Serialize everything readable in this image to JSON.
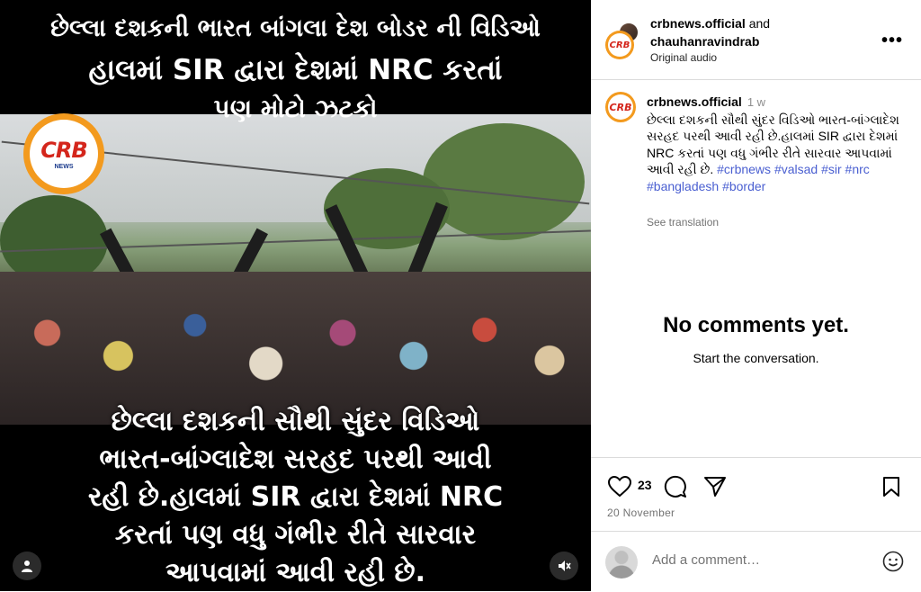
{
  "media": {
    "overlay_top": {
      "line1": "છેલ્લા દશકની ભારત બાંગલા દેશ બોડર ની વિડિઓ",
      "line2": "હાલમાં SIR દ્વારા દેશમાં NRC કરતાં",
      "line3": "પણ મોટો ઝટકો"
    },
    "overlay_bottom": [
      "છેલ્લા દશકની સૌથી સુંદર વિડિઓ",
      "ભારત-બાંગ્લાદેશ સરહદ પરથી આવી",
      "રહી છે.હાલમાં SIR દ્વારા દેશમાં NRC",
      "કરતાં પણ વધુ ગંભીર રીતે સારવાર",
      "આપવામાં આવી રહી છે."
    ],
    "logo": {
      "text": "CRB",
      "sub": "NEWS"
    },
    "icons": {
      "user": "user-tag-icon",
      "mute": "muted-speaker-icon"
    }
  },
  "header": {
    "user1": "crbnews.official",
    "and": "and",
    "user2": "chauhanravindrab",
    "subtitle": "Original audio",
    "more_label": "•••",
    "avatar_text": "CRB"
  },
  "caption": {
    "username": "crbnews.official",
    "time": "1 w",
    "text": "છેલ્લા દશકની સૌથી સુંદર વિડિઓ ભારત-બાંગ્લાદેશ સરહદ પરથી આવી રહી છે.હાલમાં SIR દ્વારા દેશમાં NRC કરતાં પણ વધુ ગંભીર રીતે સારવાર આપવામાં આવી રહી છે.",
    "hashtags": [
      "#crbnews",
      "#valsad",
      "#sir",
      "#nrc",
      "#bangladesh",
      "#border"
    ],
    "see_translation": "See translation"
  },
  "comments_empty": {
    "title": "No comments yet.",
    "subtitle": "Start the conversation."
  },
  "actions": {
    "likes": "23",
    "date": "20 November"
  },
  "add_comment": {
    "placeholder": "Add a comment…"
  },
  "colors": {
    "hashtag": "#4a5fd1",
    "logo_orange": "#f39a1e",
    "logo_red": "#d4261c",
    "muted_text": "#737373"
  }
}
